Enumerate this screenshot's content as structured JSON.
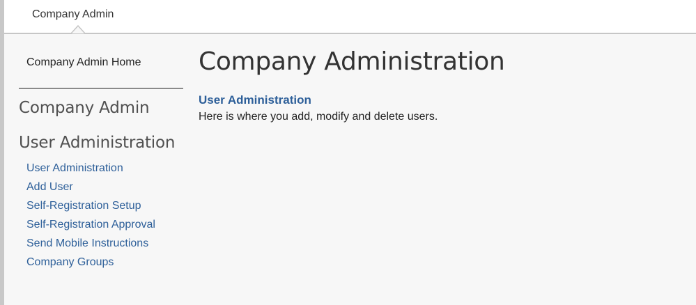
{
  "header": {
    "tab_label": "Company Admin"
  },
  "sidebar": {
    "home_label": "Company Admin Home",
    "section_company": "Company Admin",
    "section_users": "User Administration",
    "items": [
      {
        "label": "User Administration"
      },
      {
        "label": "Add User"
      },
      {
        "label": "Self-Registration Setup"
      },
      {
        "label": "Self-Registration Approval"
      },
      {
        "label": "Send Mobile Instructions"
      },
      {
        "label": "Company Groups"
      }
    ]
  },
  "main": {
    "title": "Company Administration",
    "link_label": "User Administration",
    "description": "Here is where you add, modify and delete users."
  },
  "colors": {
    "link": "#2d5f99",
    "background": "#f7f7f7",
    "header_bg": "#ffffff"
  }
}
